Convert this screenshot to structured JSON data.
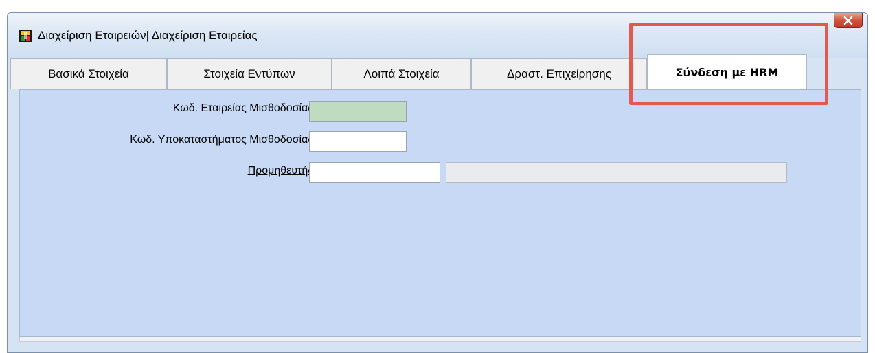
{
  "window": {
    "title": "Διαχείριση Εταιρειών| Διαχείριση Εταιρείας",
    "icon": "app-icon",
    "close_icon": "close-icon"
  },
  "tabs": [
    {
      "label": "Βασικά Στοιχεία",
      "active": false
    },
    {
      "label": "Στοιχεία Εντύπων",
      "active": false
    },
    {
      "label": "Λοιπά Στοιχεία",
      "active": false
    },
    {
      "label": "Δραστ. Επιχείρησης",
      "active": false
    },
    {
      "label": "Σύνδεση με HRM",
      "active": true
    }
  ],
  "form": {
    "company_code_label": "Κωδ. Εταιρείας Μισθοδοσίας",
    "company_code_value": "",
    "branch_code_label": "Κωδ. Υποκαταστήματος Μισθοδοσίας",
    "branch_code_value": "",
    "supplier_label": "Προμηθευτής",
    "supplier_code_value": "",
    "supplier_name_value": ""
  },
  "colors": {
    "highlight_border": "#e2594e",
    "panel_background": "#c7d9f4",
    "required_field": "#bfdcc1"
  }
}
